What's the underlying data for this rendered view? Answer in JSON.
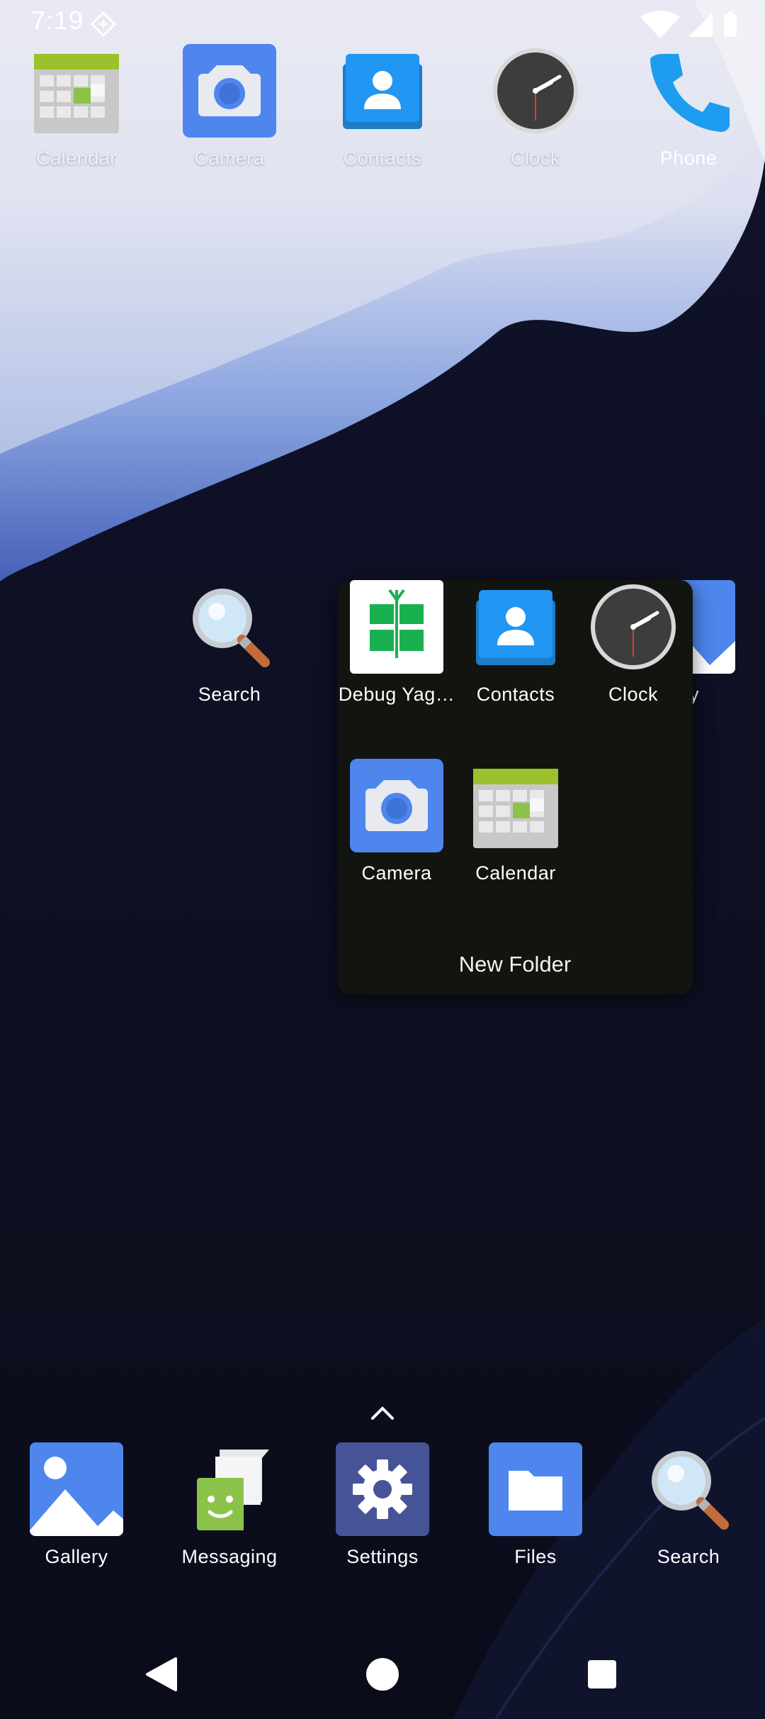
{
  "status_bar": {
    "time": "7:19",
    "notification_icon": "android-debug-icon",
    "indicators": [
      "wifi-icon",
      "signal-icon",
      "battery-icon"
    ]
  },
  "top_row": [
    {
      "label": "Calendar",
      "icon": "calendar-icon"
    },
    {
      "label": "Camera",
      "icon": "camera-icon"
    },
    {
      "label": "Contacts",
      "icon": "contacts-icon"
    },
    {
      "label": "Clock",
      "icon": "clock-icon"
    },
    {
      "label": "Phone",
      "icon": "phone-icon"
    }
  ],
  "middle_row": [
    {
      "label": "Search",
      "icon": "search-icon"
    },
    {
      "label": "ery",
      "icon": "gallery-icon"
    }
  ],
  "folder": {
    "title": "New Folder",
    "apps": [
      {
        "label": "Debug Yag…",
        "icon": "debug-yag-icon"
      },
      {
        "label": "Contacts",
        "icon": "contacts-icon"
      },
      {
        "label": "Clock",
        "icon": "clock-icon"
      },
      {
        "label": "Camera",
        "icon": "camera-icon"
      },
      {
        "label": "Calendar",
        "icon": "calendar-icon"
      }
    ]
  },
  "dock": [
    {
      "label": "Gallery",
      "icon": "gallery-icon"
    },
    {
      "label": "Messaging",
      "icon": "messaging-icon"
    },
    {
      "label": "Settings",
      "icon": "settings-icon"
    },
    {
      "label": "Files",
      "icon": "files-icon"
    },
    {
      "label": "Search",
      "icon": "search-icon"
    }
  ],
  "nav": [
    "back-icon",
    "home-icon",
    "recents-icon"
  ],
  "colors": {
    "wallpaper_dark": "#0c0e1f",
    "wallpaper_light": "#e9eaf2",
    "accent_blue": "#4e86ee",
    "folder_bg": "#121410"
  }
}
